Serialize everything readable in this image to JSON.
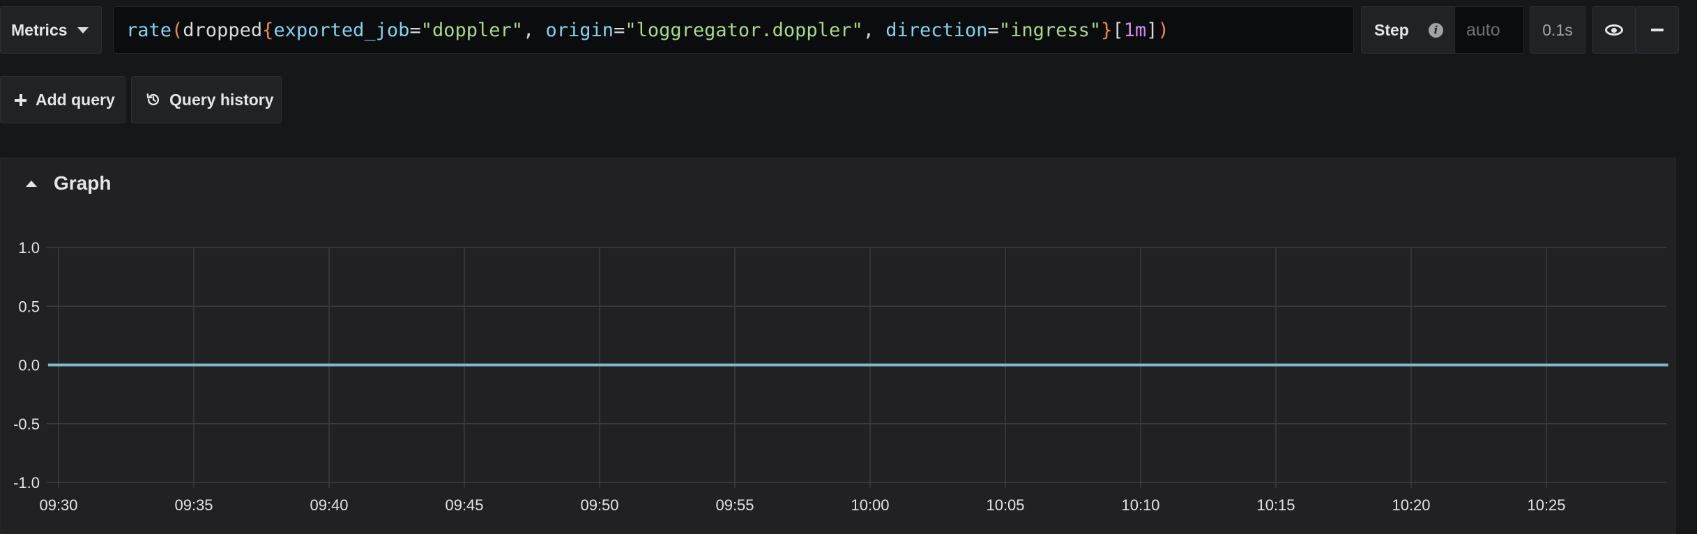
{
  "query_row": {
    "datasource_label": "Metrics",
    "query_tokens": [
      {
        "t": "rate",
        "c": "tok-fn"
      },
      {
        "t": "(",
        "c": "tok-brace"
      },
      {
        "t": "dropped",
        "c": "tok-metric"
      },
      {
        "t": "{",
        "c": "tok-brace"
      },
      {
        "t": "exported_job",
        "c": "tok-label"
      },
      {
        "t": "=",
        "c": "tok-op"
      },
      {
        "t": "\"doppler\"",
        "c": "tok-str"
      },
      {
        "t": ", ",
        "c": "tok-op"
      },
      {
        "t": "origin",
        "c": "tok-label"
      },
      {
        "t": "=",
        "c": "tok-op"
      },
      {
        "t": "\"loggregator.doppler\"",
        "c": "tok-str"
      },
      {
        "t": ", ",
        "c": "tok-op"
      },
      {
        "t": "direction",
        "c": "tok-label"
      },
      {
        "t": "=",
        "c": "tok-op"
      },
      {
        "t": "\"ingress\"",
        "c": "tok-str"
      },
      {
        "t": "}",
        "c": "tok-brace"
      },
      {
        "t": "[",
        "c": "tok-br"
      },
      {
        "t": "1m",
        "c": "tok-dur"
      },
      {
        "t": "]",
        "c": "tok-br"
      },
      {
        "t": ")",
        "c": "tok-brace"
      }
    ],
    "step_label": "Step",
    "step_placeholder": "auto",
    "query_time": "0.1s"
  },
  "actions": {
    "add_query_label": "Add query",
    "query_history_label": "Query history"
  },
  "graph": {
    "title": "Graph"
  },
  "chart_data": {
    "type": "line",
    "x": [
      "09:30",
      "09:35",
      "09:40",
      "09:45",
      "09:50",
      "09:55",
      "10:00",
      "10:05",
      "10:10",
      "10:15",
      "10:20",
      "10:25"
    ],
    "y_ticks": [
      "1.0",
      "0.5",
      "0.0",
      "-0.5",
      "-1.0"
    ],
    "ylim": [
      -1.0,
      1.0
    ],
    "series": [
      {
        "color": "#7eb8c9",
        "values": [
          0,
          0,
          0,
          0,
          0,
          0,
          0,
          0,
          0,
          0,
          0,
          0,
          0
        ]
      }
    ],
    "x_end_extension_minutes": 4.5,
    "grid": true
  }
}
